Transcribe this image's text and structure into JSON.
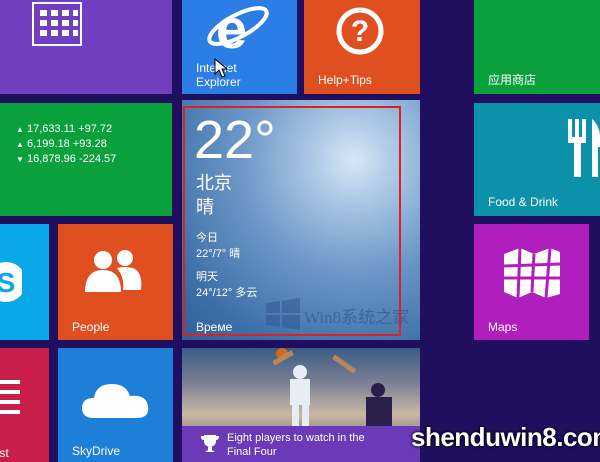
{
  "tiles": {
    "calendar": {
      "label": ""
    },
    "ie": {
      "label_line1": "Internet",
      "label_line2": "Explorer"
    },
    "help": {
      "label": "Help+Tips"
    },
    "store": {
      "label": "应用商店"
    },
    "finance": {
      "rows": [
        {
          "arrow": "▲",
          "value": "17,633.11 +97.72"
        },
        {
          "arrow": "▲",
          "value": "6,199.18 +93.28"
        },
        {
          "arrow": "▼",
          "value": "16,878.96 -224.57"
        }
      ]
    },
    "weather": {
      "temp": "22°",
      "city": "北京",
      "condition": "晴",
      "today_label": "今日",
      "today_value": "22°/7° 晴",
      "tomorrow_label": "明天",
      "tomorrow_value": "24°/12° 多云",
      "label": "Време"
    },
    "people": {
      "label": "People"
    },
    "food": {
      "label": "Food & Drink"
    },
    "maps": {
      "label": "Maps"
    },
    "list": {
      "label": "List"
    },
    "skydrive": {
      "label": "SkyDrive"
    },
    "sports": {
      "caption_line1": "Eight players to watch in the",
      "caption_line2": "Final Four"
    }
  },
  "watermarks": {
    "center": "Win8系统之家",
    "corner": "shenduwin8.com"
  },
  "colors": {
    "background": "#1f0f5e",
    "highlight_border": "#e02020"
  }
}
